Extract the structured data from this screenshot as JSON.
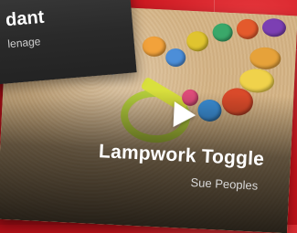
{
  "cards": [
    {
      "title": "dant",
      "author": "lenage"
    },
    {
      "title": "Lampwork Toggle",
      "author": "Sue Peoples"
    }
  ],
  "icons": {
    "play": "play-icon"
  },
  "colors": {
    "background": "#c8121b",
    "title": "#ffffff",
    "author": "#d9d9d9"
  }
}
